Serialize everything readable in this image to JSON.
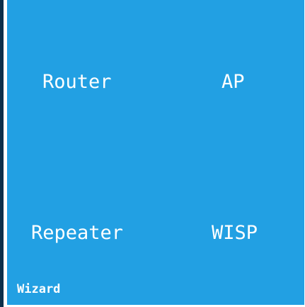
{
  "colors": {
    "panel_background": "#22a0e3",
    "text": "#ffffff",
    "left_border": "#0c2f4a"
  },
  "modes": {
    "router": "Router",
    "ap": "AP",
    "repeater": "Repeater",
    "wisp": "WISP"
  },
  "footer": {
    "wizard_label": "Wizard"
  }
}
